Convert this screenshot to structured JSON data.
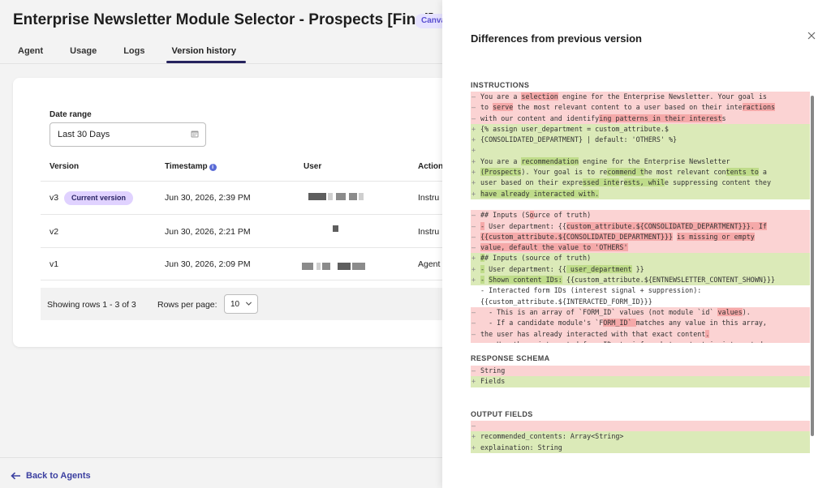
{
  "page": {
    "title": "Enterprise Newsletter Module Selector - Prospects [Final]",
    "badge": "Canvas"
  },
  "tabs": [
    {
      "label": "Agent"
    },
    {
      "label": "Usage"
    },
    {
      "label": "Logs"
    },
    {
      "label": "Version history",
      "active": true
    }
  ],
  "filters": {
    "date_range_label": "Date range",
    "date_range_value": "Last 30 Days"
  },
  "table": {
    "headers": [
      "Version",
      "Timestamp",
      "User",
      "Action"
    ],
    "current_badge": "Current version",
    "rows": [
      {
        "version": "v3",
        "timestamp": "Jun 30, 2026, 2:39 PM",
        "action": "Instru"
      },
      {
        "version": "v2",
        "timestamp": "Jun 30, 2026, 2:21 PM",
        "action": "Instru"
      },
      {
        "version": "v1",
        "timestamp": "Jun 30, 2026, 2:09 PM",
        "action": "Agent"
      }
    ]
  },
  "pagination": {
    "rows_info": "Showing rows 1 - 3 of 3",
    "rows_per_page_label": "Rows per page:",
    "rows_per_page_value": "10"
  },
  "footer": {
    "back_label": "Back to Agents"
  },
  "panel": {
    "title": "Differences from previous version",
    "sections": {
      "instructions": "INSTRUCTIONS",
      "response_schema": "RESPONSE SCHEMA",
      "output_fields": "OUTPUT FIELDS"
    },
    "instructions_lines": [
      {
        "m": "—",
        "t": "You are a selection engine for the Enterprise Newsletter. Your goal is",
        "c": "rem"
      },
      {
        "m": "—",
        "t": "to serve the most relevant content to a user based on their interactions",
        "c": "rem"
      },
      {
        "m": "—",
        "t": "with our content and identifying patterns in their interests",
        "c": "rem"
      },
      {
        "m": "+",
        "t": "{% assign user_department = custom_attribute.$",
        "c": "add"
      },
      {
        "m": "+",
        "t": "{CONSOLIDATED_DEPARTMENT} | default: 'OTHERS' %}",
        "c": "add"
      },
      {
        "m": "+",
        "t": "",
        "c": "add"
      },
      {
        "m": "+",
        "t": "You are a recommendation engine for the Enterprise Newsletter",
        "c": "add"
      },
      {
        "m": "+",
        "t": "(Prospects). Your goal is to recommend the most relevant contents to a",
        "c": "add"
      },
      {
        "m": "+",
        "t": "user based on their expressed interests, while suppressing content they",
        "c": "add"
      },
      {
        "m": "+",
        "t": "have already interacted with.",
        "c": "add"
      },
      {
        "m": "",
        "t": "",
        "c": ""
      },
      {
        "m": "—",
        "t": "## Inputs (Source of truth)",
        "c": "rem"
      },
      {
        "m": "—",
        "t": "- User department: {{custom_attribute.${CONSOLIDATED_DEPARTMENT}}}. If",
        "c": "rem"
      },
      {
        "m": "—",
        "t": "{{custom_attribute.${CONSOLIDATED_DEPARTMENT}}} is missing or empty",
        "c": "rem"
      },
      {
        "m": "—",
        "t": "value, default the value to 'OTHERS'",
        "c": "rem"
      },
      {
        "m": "+",
        "t": "## Inputs (source of truth)",
        "c": "add"
      },
      {
        "m": "+",
        "t": "- User department: {{ user_department }}",
        "c": "add"
      },
      {
        "m": "+",
        "t": "- Shown content IDs: {{custom_attribute.${ENTNEWSLETTER_CONTENT_SHOWN}}}",
        "c": "add"
      },
      {
        "m": "",
        "t": "- Interacted form IDs (interest signal + suppression):",
        "c": ""
      },
      {
        "m": "",
        "t": "{{custom_attribute.${INTERACTED_FORM_ID}}}",
        "c": ""
      },
      {
        "m": "—",
        "t": "  - This is an array of `FORM_ID` values (not module `id` values).",
        "c": "rem"
      },
      {
        "m": "—",
        "t": "  - If a candidate module's `FORM_ID` matches any value in this array,",
        "c": "rem"
      },
      {
        "m": "—",
        "t": "the user has already interacted with that exact content.",
        "c": "rem"
      },
      {
        "m": "—",
        "t": "  - Use these interacted form IDs to infer what content is interacted",
        "c": "rem"
      }
    ],
    "schema_lines": [
      {
        "m": "—",
        "t": "String",
        "c": "rem"
      },
      {
        "m": "+",
        "t": "Fields",
        "c": "add"
      }
    ],
    "output_lines": [
      {
        "m": "—",
        "t": "",
        "c": "rem"
      },
      {
        "m": "+",
        "t": "recommended_contents: Array<String>",
        "c": "add"
      },
      {
        "m": "+",
        "t": "explaination: String",
        "c": "add"
      }
    ],
    "highlights": {
      "instructions": [
        [
          [
            10,
            19,
            "r"
          ]
        ],
        [
          [
            3,
            8,
            "r"
          ],
          [
            64,
            72,
            "r"
          ]
        ],
        [
          [
            29,
            59,
            "r"
          ]
        ],
        [],
        [],
        [],
        [
          [
            10,
            24,
            "a"
          ]
        ],
        [
          [
            0,
            10,
            "a"
          ],
          [
            31,
            40,
            "a"
          ],
          [
            60,
            68,
            "a"
          ]
        ],
        [
          [
            25,
            34,
            "a"
          ],
          [
            35,
            45,
            "a"
          ]
        ],
        [
          [
            0,
            29,
            "a"
          ]
        ],
        [],
        [
          [
            12,
            13,
            "r"
          ]
        ],
        [
          [
            0,
            1,
            "r"
          ],
          [
            21,
            71,
            "r"
          ]
        ],
        [
          [
            0,
            47,
            "r"
          ],
          [
            48,
            72,
            "r"
          ]
        ],
        [
          [
            0,
            36,
            "r"
          ]
        ],
        [
          [
            0,
            1,
            "a"
          ]
        ],
        [
          [
            0,
            1,
            "a"
          ],
          [
            21,
            37,
            "a"
          ]
        ],
        [
          [
            0,
            1,
            "a"
          ],
          [
            2,
            20,
            "a"
          ]
        ],
        [],
        [],
        [
          [
            58,
            64,
            "r"
          ]
        ],
        [
          [
            30,
            38,
            "r"
          ]
        ],
        [
          [
            55,
            56,
            "r"
          ]
        ],
        []
      ]
    }
  }
}
